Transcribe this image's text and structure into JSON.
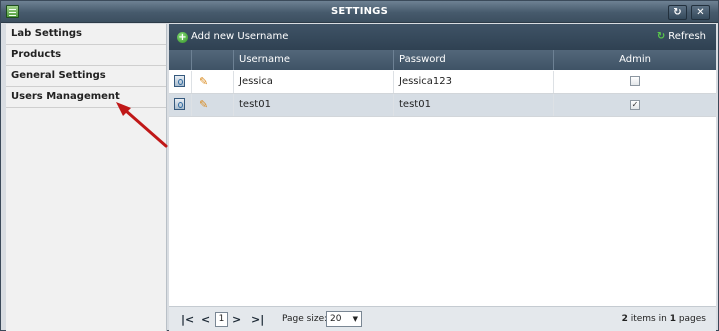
{
  "window": {
    "title": "SETTINGS"
  },
  "sidebar": {
    "items": [
      {
        "label": "Lab Settings"
      },
      {
        "label": "Products"
      },
      {
        "label": "General Settings"
      },
      {
        "label": "Users Management"
      }
    ]
  },
  "toolbar": {
    "add_label": "Add new Username",
    "refresh_label": "Refresh"
  },
  "grid": {
    "columns": {
      "username": "Username",
      "password": "Password",
      "admin": "Admin"
    },
    "rows": [
      {
        "username": "Jessica",
        "password": "Jessica123",
        "admin": false
      },
      {
        "username": "test01",
        "password": "test01",
        "admin": true
      }
    ]
  },
  "pager": {
    "page": "1",
    "page_size_label": "Page size:",
    "page_size": "20",
    "items_count": "2",
    "items_text": "items in",
    "pages_count": "1",
    "pages_text": "pages"
  },
  "colors": {
    "titlebar": "#465a6c",
    "selected_row": "#d6dde4",
    "annotation_arrow": "#c01818"
  },
  "icons": [
    "window-icon",
    "refresh-icon",
    "close-icon",
    "add-icon",
    "delete-icon",
    "edit-icon",
    "checkbox-icon",
    "first-page-icon",
    "prev-page-icon",
    "next-page-icon",
    "last-page-icon",
    "dropdown-arrow-icon"
  ]
}
